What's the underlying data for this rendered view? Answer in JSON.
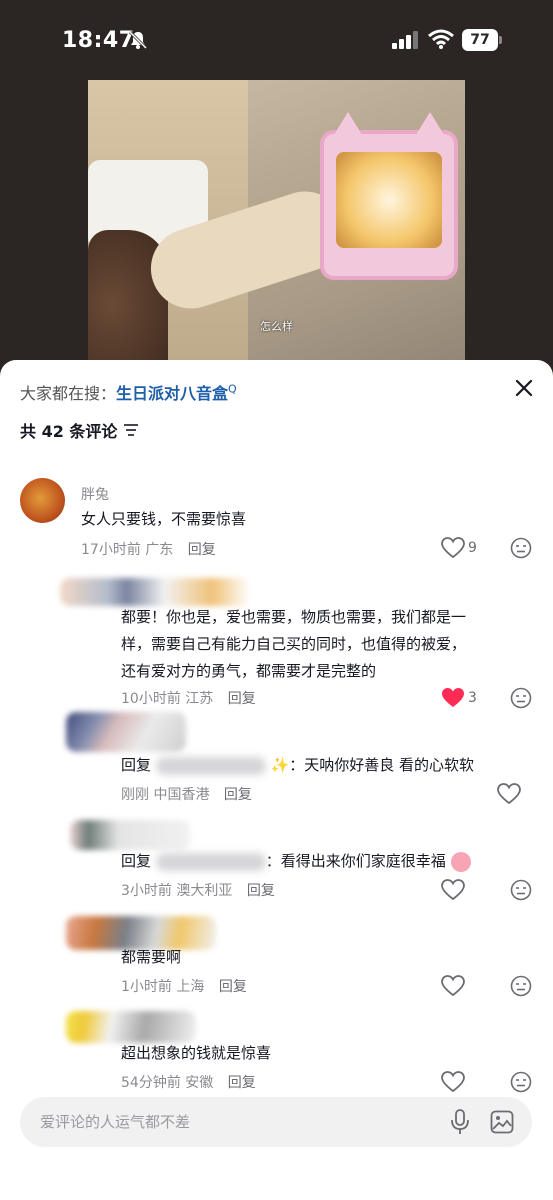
{
  "status_bar": {
    "time": "18:47",
    "battery": "77"
  },
  "video": {
    "caption": "怎么样"
  },
  "sheet": {
    "search_prefix": "大家都在搜：",
    "search_keyword": "生日派对八音盒",
    "comment_count_label": "共 42 条评论"
  },
  "comments": [
    {
      "name": "胖兔",
      "text": "女人只要钱，不需要惊喜",
      "time": "17小时前",
      "location": "广东",
      "reply": "回复",
      "likes": "9"
    },
    {
      "name": "",
      "text_lines": [
        "都要！你也是，爱也需要，物质也需要，我们都是一",
        "样，需要自己有能力自己买的同时，也值得的被爱，",
        "还有爱对方的勇气，都需要才是完整的"
      ],
      "time": "10小时前",
      "location": "江苏",
      "reply": "回复",
      "likes": "3"
    },
    {
      "prefix": "回复",
      "suffix": "：天呐你好善良 看的心软软",
      "time": "刚刚",
      "location": "中国香港",
      "reply": "回复"
    },
    {
      "prefix": "回复",
      "suffix": "：看得出来你们家庭很幸福",
      "time": "3小时前",
      "location": "澳大利亚",
      "reply": "回复"
    },
    {
      "text": "都需要啊",
      "time": "1小时前",
      "location": "上海",
      "reply": "回复"
    },
    {
      "text": "超出想象的钱就是惊喜",
      "time": "54分钟前",
      "location": "安徽",
      "reply": "回复"
    }
  ],
  "input": {
    "placeholder": "爱评论的人运气都不差"
  },
  "colors": {
    "liked": "#fe2c55",
    "keyword": "#1d5fa8",
    "meta": "#8a8b91"
  }
}
